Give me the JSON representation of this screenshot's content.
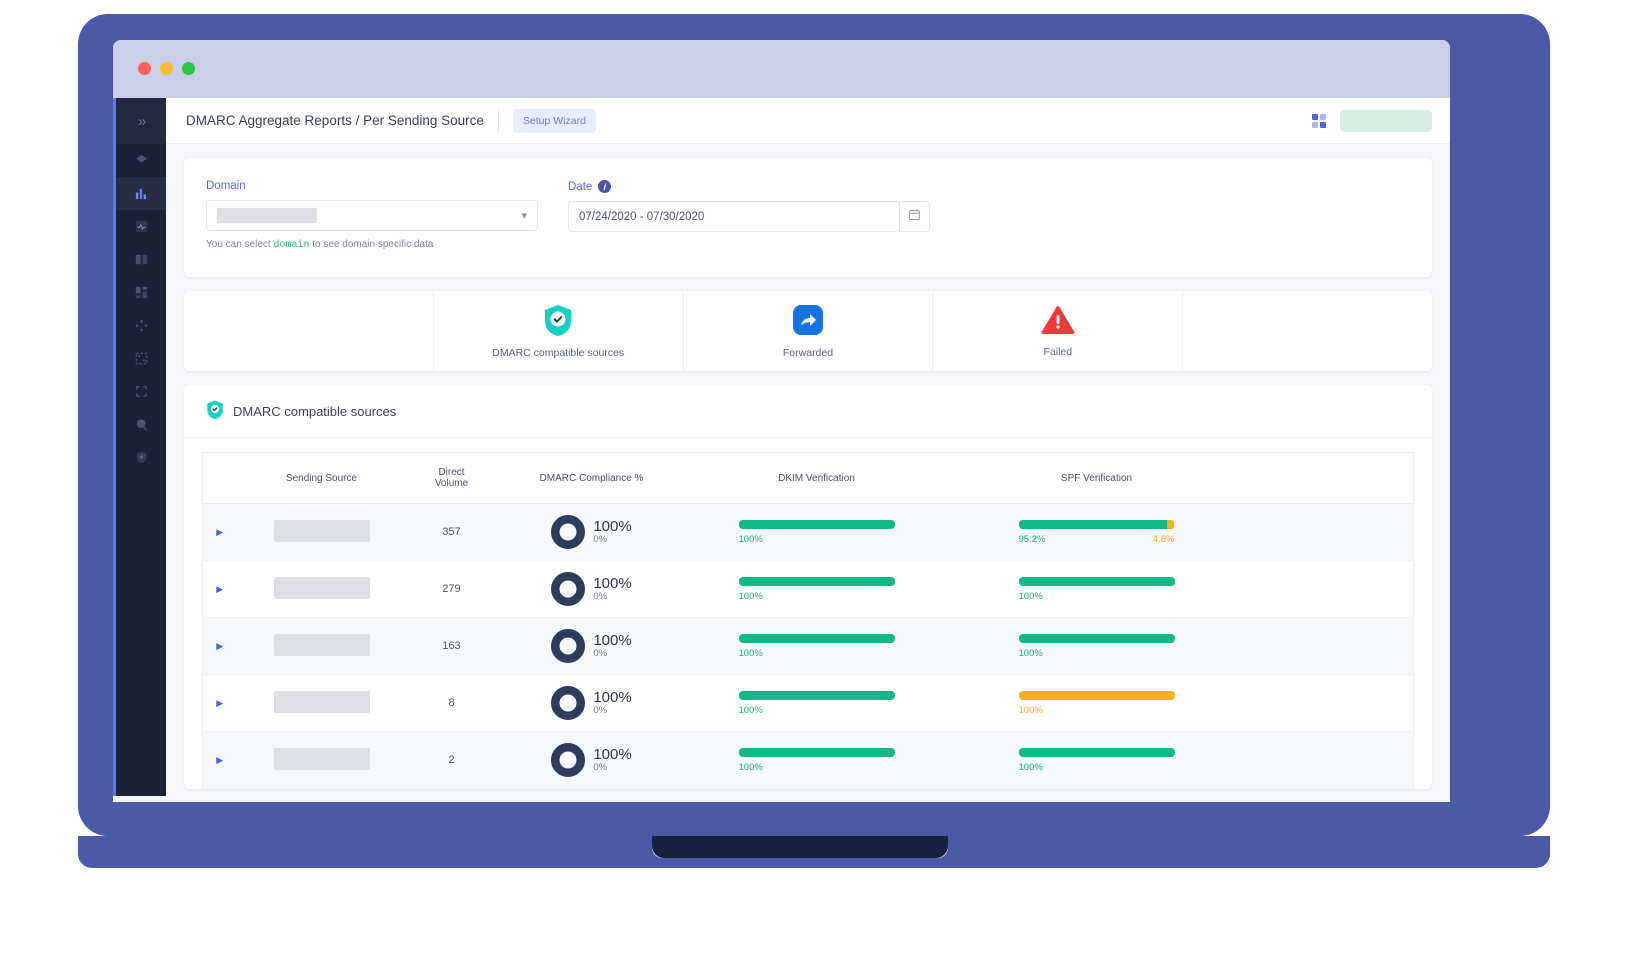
{
  "window": {
    "dots": [
      "close",
      "minimize",
      "maximize"
    ]
  },
  "sidebar": {
    "expand_label": "»",
    "items": [
      {
        "name": "layers",
        "active": false
      },
      {
        "name": "bar-chart",
        "active": true
      },
      {
        "name": "activity",
        "active": false
      },
      {
        "name": "book",
        "active": false
      },
      {
        "name": "dashboard",
        "active": false
      },
      {
        "name": "nodes",
        "active": false
      },
      {
        "name": "dashed-box",
        "active": false
      },
      {
        "name": "brackets",
        "active": false
      },
      {
        "name": "globe",
        "active": false
      },
      {
        "name": "shield",
        "active": false
      }
    ]
  },
  "topbar": {
    "breadcrumb": "DMARC Aggregate Reports / Per Sending Source",
    "setup_wizard": "Setup Wizard"
  },
  "filters": {
    "domain_label": "Domain",
    "domain_value": "",
    "domain_helper_pre": "You can select",
    "domain_helper_code": "domain",
    "domain_helper_post": "to see domain specific data",
    "date_label": "Date",
    "date_value": "07/24/2020 - 07/30/2020"
  },
  "stats": [
    {
      "label": "DMARC compatible sources",
      "icon": "shield-check-icon",
      "color": "#16cfc4"
    },
    {
      "label": "Forwarded",
      "icon": "forward-arrow-icon",
      "color": "#1573e6"
    },
    {
      "label": "Failed",
      "icon": "warning-triangle-icon",
      "color": "#ec3b3b"
    }
  ],
  "table": {
    "section_title": "DMARC compatible sources",
    "headers": [
      "",
      "Sending Source",
      "Direct Volume",
      "DMARC Compliance %",
      "DKIM Verification",
      "SPF Verification"
    ],
    "header_direct": "Direct",
    "header_volume": "Volume",
    "rows": [
      {
        "volume": "357",
        "compliance_top": "100%",
        "compliance_bottom": "0%",
        "compliance_pct": 100,
        "dkim": {
          "segments": [
            {
              "pct": 100,
              "color": "#12b886"
            }
          ],
          "labels": [
            {
              "text": "100%",
              "style": "green"
            }
          ]
        },
        "spf": {
          "segments": [
            {
              "pct": 95.2,
              "color": "#12b886"
            },
            {
              "pct": 4.8,
              "color": "#f6b01e"
            }
          ],
          "labels": [
            {
              "text": "95.2%",
              "style": "green"
            },
            {
              "text": "4.8%",
              "style": "amber"
            }
          ]
        }
      },
      {
        "volume": "279",
        "compliance_top": "100%",
        "compliance_bottom": "0%",
        "compliance_pct": 100,
        "dkim": {
          "segments": [
            {
              "pct": 100,
              "color": "#12b886"
            }
          ],
          "labels": [
            {
              "text": "100%",
              "style": "green"
            }
          ]
        },
        "spf": {
          "segments": [
            {
              "pct": 100,
              "color": "#12b886"
            }
          ],
          "labels": [
            {
              "text": "100%",
              "style": "green"
            }
          ]
        }
      },
      {
        "volume": "163",
        "compliance_top": "100%",
        "compliance_bottom": "0%",
        "compliance_pct": 100,
        "dkim": {
          "segments": [
            {
              "pct": 100,
              "color": "#12b886"
            }
          ],
          "labels": [
            {
              "text": "100%",
              "style": "green"
            }
          ]
        },
        "spf": {
          "segments": [
            {
              "pct": 100,
              "color": "#12b886"
            }
          ],
          "labels": [
            {
              "text": "100%",
              "style": "green"
            }
          ]
        }
      },
      {
        "volume": "8",
        "compliance_top": "100%",
        "compliance_bottom": "0%",
        "compliance_pct": 100,
        "dkim": {
          "segments": [
            {
              "pct": 100,
              "color": "#12b886"
            }
          ],
          "labels": [
            {
              "text": "100%",
              "style": "green"
            }
          ]
        },
        "spf": {
          "segments": [
            {
              "pct": 100,
              "color": "#f6b01e"
            }
          ],
          "labels": [
            {
              "text": "100%",
              "style": "amber"
            }
          ]
        }
      },
      {
        "volume": "2",
        "compliance_top": "100%",
        "compliance_bottom": "0%",
        "compliance_pct": 100,
        "dkim": {
          "segments": [
            {
              "pct": 100,
              "color": "#12b886"
            }
          ],
          "labels": [
            {
              "text": "100%",
              "style": "green"
            }
          ]
        },
        "spf": {
          "segments": [
            {
              "pct": 100,
              "color": "#12b886"
            }
          ],
          "labels": [
            {
              "text": "100%",
              "style": "green"
            }
          ]
        }
      }
    ]
  },
  "colors": {
    "accent": "#4a63d8",
    "green": "#12b886",
    "amber": "#f6b01e",
    "red": "#ec3b3b",
    "teal": "#16cfc4",
    "blue": "#1573e6",
    "sidebar_bg": "#1b2238",
    "laptop": "#4a5aa8"
  }
}
